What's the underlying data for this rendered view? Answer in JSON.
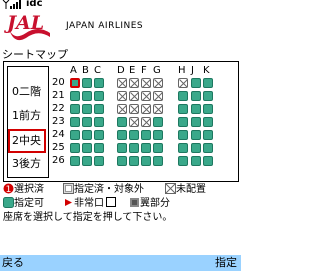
{
  "status": {
    "icons": [
      "antenna-icon",
      "signal-bars-icon"
    ],
    "text": "idc"
  },
  "header": {
    "airline_name": "JAPAN AIRLINES",
    "brand_color": "#c8102e"
  },
  "page": {
    "title": "シートマップ"
  },
  "zones": [
    {
      "num": "0",
      "label": "二階",
      "selected": false
    },
    {
      "num": "1",
      "label": "前方",
      "selected": false
    },
    {
      "num": "2",
      "label": "中央",
      "selected": true
    },
    {
      "num": "3",
      "label": "後方",
      "selected": false
    }
  ],
  "seatmap": {
    "columns": [
      "A",
      "B",
      "C",
      "D",
      "E",
      "F",
      "G",
      "H",
      "J",
      "K"
    ],
    "rows": [
      "20",
      "21",
      "22",
      "23",
      "24",
      "25",
      "26"
    ],
    "legend_row": [
      "sel,avail,avail,na,na,na,na,na,avail,avail",
      "avail,avail,avail,na,na,na,na,avail,avail,avail",
      "avail,avail,avail,na,na,na,na,avail,avail,avail",
      "avail,avail,avail,avail,na,na,avail,avail,avail,avail",
      "avail,avail,avail,avail,avail,avail,avail,avail,avail,avail",
      "avail,avail,avail,avail,avail,avail,avail,avail,avail,avail",
      "avail,avail,avail,avail,avail,avail,avail,avail,avail,avail"
    ]
  },
  "legend": {
    "selecting": "選択済",
    "reserved_target": "指定済・対象外",
    "unassigned": "未配置",
    "available": "指定可",
    "emergency_exit": "非常口",
    "wing": "翼部分"
  },
  "instruction": "座席を選択して指定を押して下さい。",
  "softkeys": {
    "left": "戻る",
    "right": "指定"
  },
  "colors": {
    "seat_available": "#3aa88a",
    "selection_red": "#d20000",
    "softkey_bar": "#9ad2ff"
  }
}
